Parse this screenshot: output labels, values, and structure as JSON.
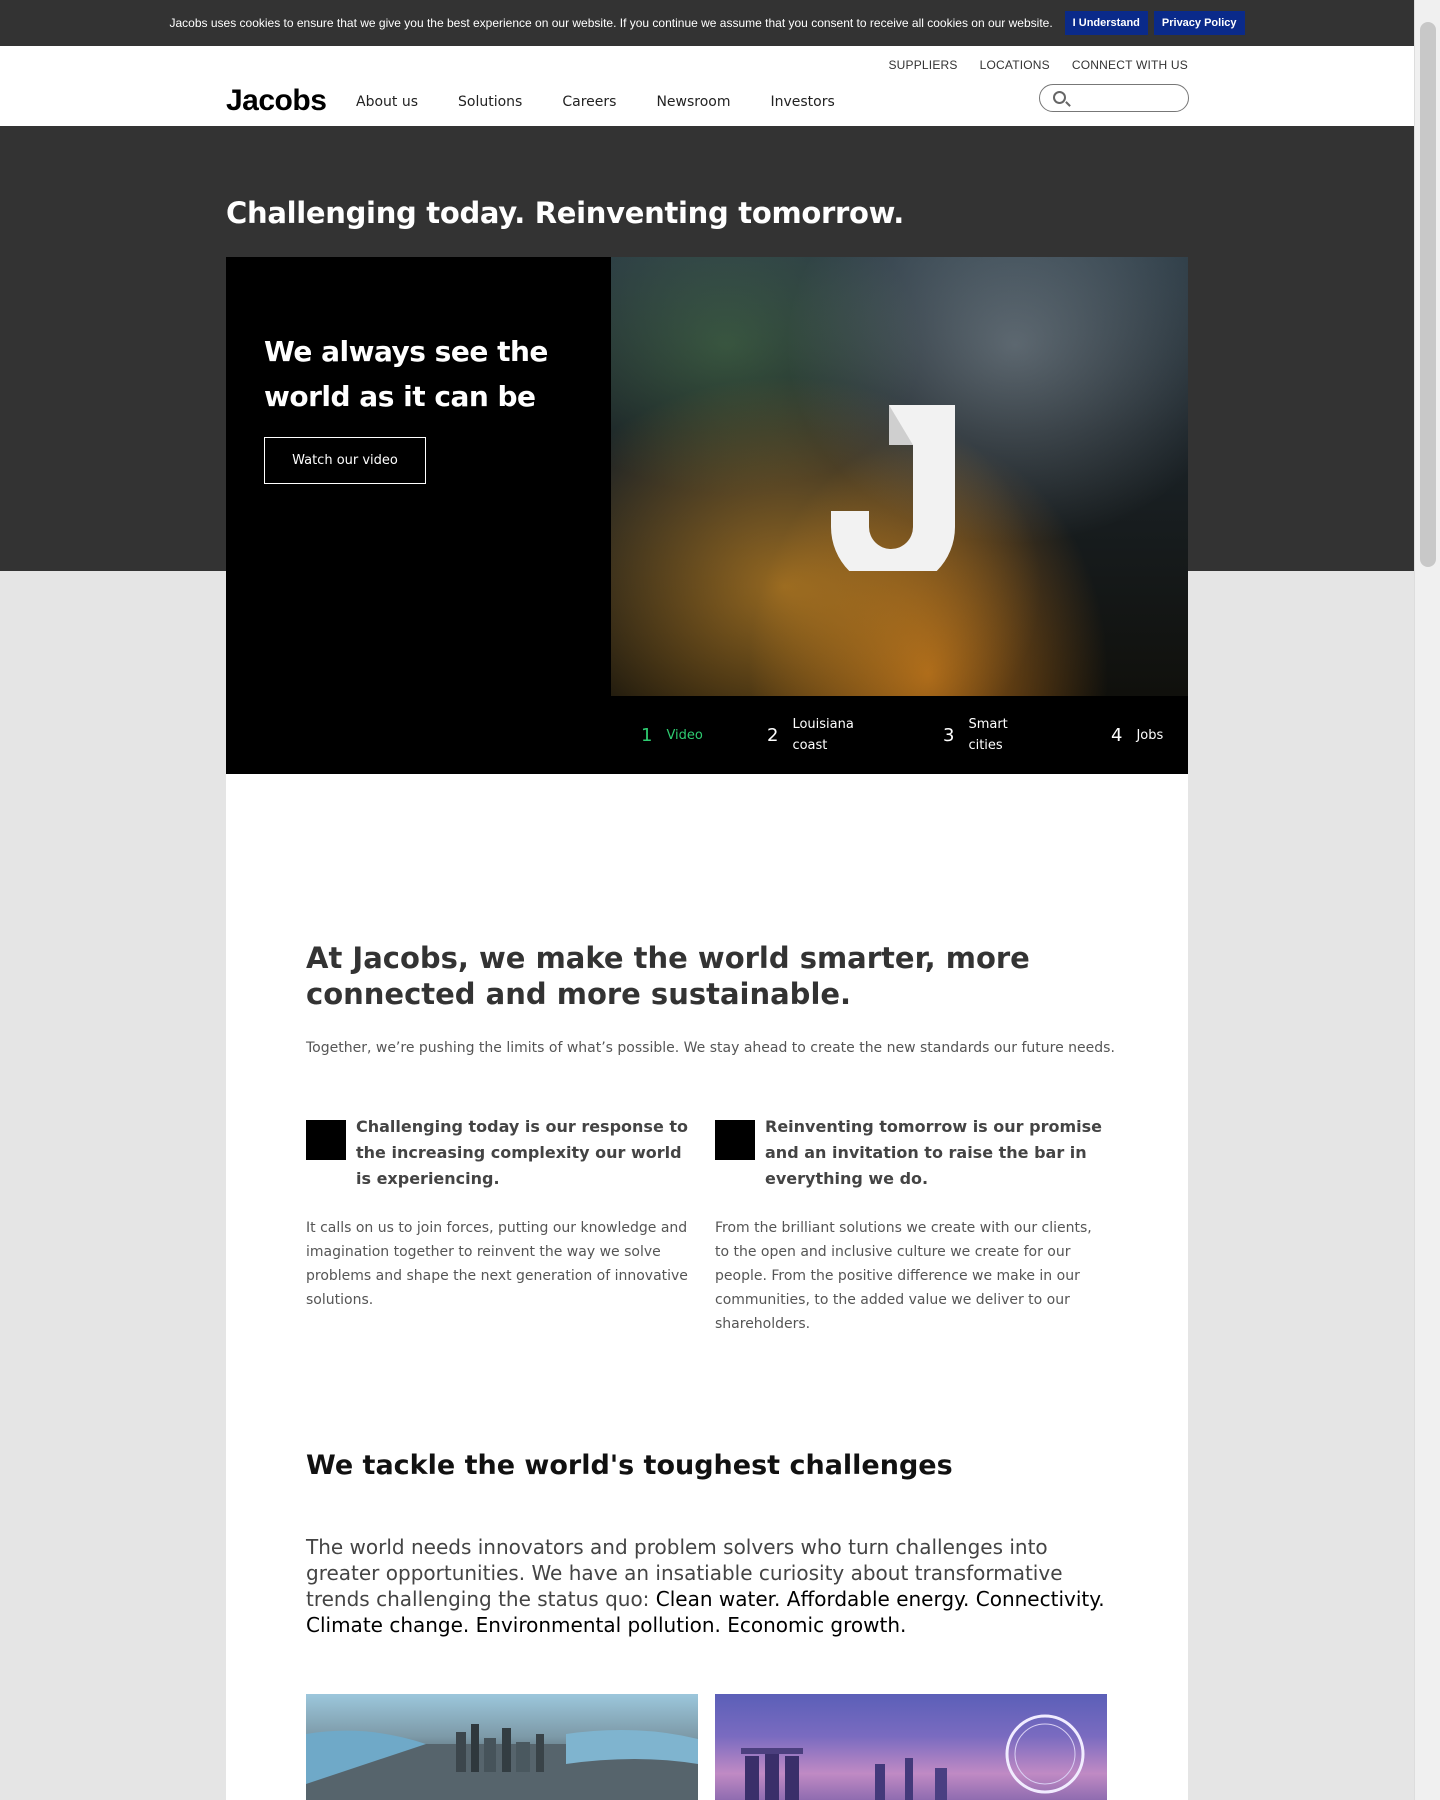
{
  "cookie_bar": {
    "text": "Jacobs uses cookies to ensure that we give you the best experience on our website. If you continue we assume that you consent to receive all cookies on our website.",
    "understand_label": "I Understand",
    "privacy_label": "Privacy Policy"
  },
  "header": {
    "logo": "Jacobs",
    "utility_links": [
      "SUPPLIERS",
      "LOCATIONS",
      "CONNECT WITH US"
    ],
    "nav": [
      "About us",
      "Solutions",
      "Careers",
      "Newsroom",
      "Investors"
    ],
    "search_placeholder": ""
  },
  "hero": {
    "title": "Challenging today. Reinventing tomorrow.",
    "heading": "We always see the world as it can be",
    "button_label": "Watch our video",
    "tabs": [
      {
        "num": "1",
        "label": "Video",
        "active": true
      },
      {
        "num": "2",
        "label": "Louisiana coast",
        "active": false
      },
      {
        "num": "3",
        "label": "Smart cities",
        "active": false
      },
      {
        "num": "4",
        "label": "Jobs",
        "active": false
      }
    ]
  },
  "intro": {
    "heading": "At Jacobs, we make the world smarter, more connected and more sustainable.",
    "subtext": "Together, we’re pushing the limits of what’s possible. We stay ahead to create the new standards our future needs.",
    "columns": [
      {
        "lead": "Challenging today is our response to the increasing complexity our world is experiencing.",
        "body": "It calls on us to join forces, putting our knowledge and imagination together to reinvent the way we solve problems and shape the next generation of innovative solutions."
      },
      {
        "lead": "Reinventing tomorrow is our promise and an invitation to raise the bar in everything we do.",
        "body": "From the brilliant solutions we create with our clients, to the open and inclusive culture we create for our people. From the positive difference we make in our communities, to the added value we deliver to our shareholders."
      }
    ]
  },
  "challenges": {
    "heading": "We tackle the world's toughest challenges",
    "body_intro": "The world needs innovators and problem solvers who turn challenges into greater opportunities. We have an insatiable curiosity about transformative trends challenging the status quo: ",
    "body_highlight": "Clean water. Affordable energy. Connectivity. Climate change. Environmental pollution. Economic growth."
  },
  "colors": {
    "accent_green": "#2ecc71",
    "cookie_button": "#0a2a8a",
    "hero_background": "#333333"
  }
}
